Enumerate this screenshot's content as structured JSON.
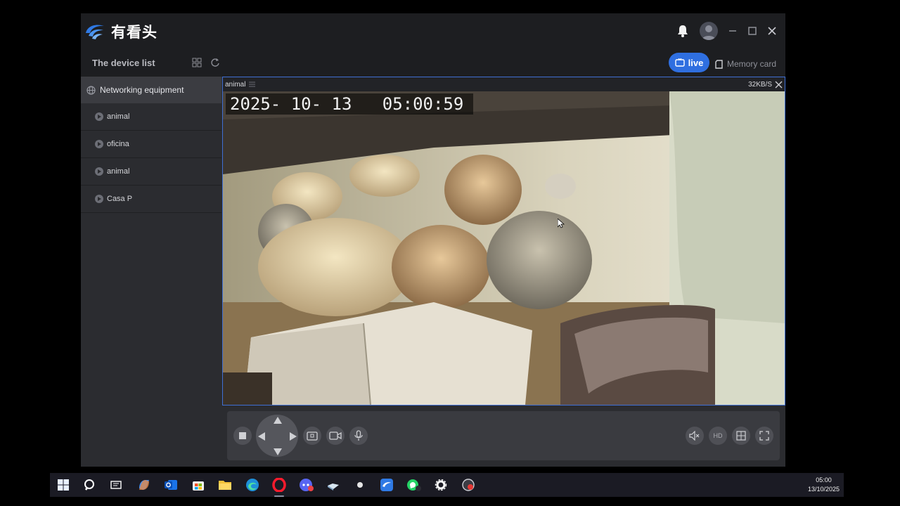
{
  "app": {
    "logo_text": "有看头",
    "subbar_title": "The device list",
    "live_label": "live",
    "memory_label": "Memory card",
    "colors": {
      "accent": "#2f6fe0",
      "selection_border": "#3f6fd4"
    }
  },
  "sidebar": {
    "group_label": "Networking equipment",
    "items": [
      {
        "label": "animal"
      },
      {
        "label": "oficina"
      },
      {
        "label": "animal"
      },
      {
        "label": "Casa P"
      }
    ]
  },
  "video": {
    "camera_name": "animal",
    "bitrate": "32KB/S",
    "osd_timestamp": "2025- 10- 13   05:00:59"
  },
  "controls": {
    "hd_label": "HD",
    "icons": [
      "stop-icon",
      "ptz-up-icon",
      "ptz-down-icon",
      "ptz-left-icon",
      "ptz-right-icon",
      "snapshot-icon",
      "record-icon",
      "microphone-icon",
      "mute-icon",
      "grid-layout-icon",
      "fullscreen-icon"
    ]
  },
  "taskbar": {
    "time": "05:00",
    "date": "13/10/2025",
    "apps": [
      "windows-start-icon",
      "search-icon",
      "task-view-icon",
      "copilot-icon",
      "outlook-icon",
      "store-icon",
      "file-explorer-icon",
      "edge-icon",
      "opera-icon",
      "discord-icon",
      "steam-icon",
      "media-icon",
      "camera-app-icon",
      "whatsapp-icon",
      "settings-icon",
      "recorder-icon"
    ]
  }
}
